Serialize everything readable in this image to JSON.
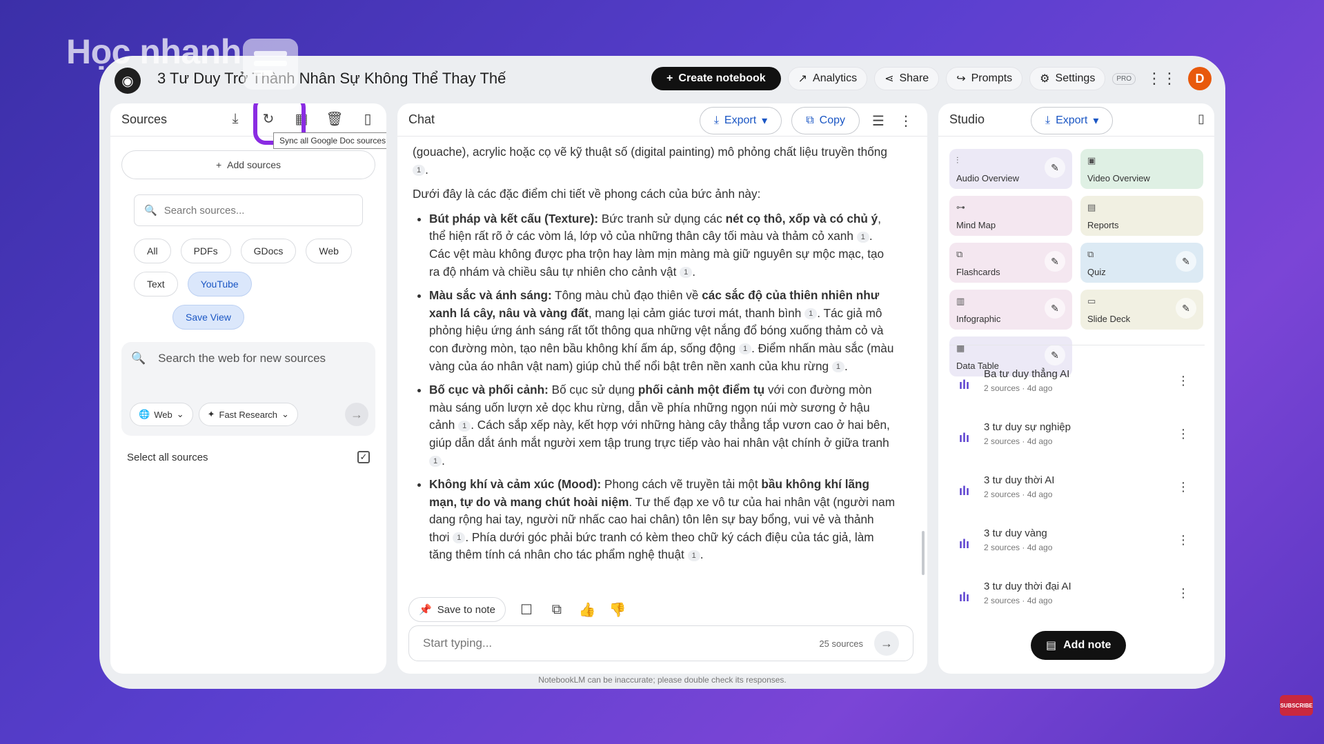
{
  "watermark": {
    "brand": "Học nhanh"
  },
  "topbar": {
    "notebook_title": "3 Tư Duy Trở Thành Nhân Sự Không Thể Thay Thế",
    "create_notebook": "Create notebook",
    "analytics": "Analytics",
    "share": "Share",
    "prompts": "Prompts",
    "settings": "Settings",
    "pro_badge": "PRO",
    "avatar_letter": "D"
  },
  "sources": {
    "title": "Sources",
    "tooltip": "Sync all Google Doc sources",
    "add_sources": "Add sources",
    "search_placeholder": "Search sources...",
    "filters": [
      "All",
      "PDFs",
      "GDocs",
      "Web",
      "Text",
      "YouTube"
    ],
    "active_filter": "YouTube",
    "save_view": "Save View",
    "web_search_placeholder": "Search the web for new sources",
    "web_option": "Web",
    "research_option": "Fast Research",
    "select_all": "Select all sources"
  },
  "chat": {
    "title": "Chat",
    "export": "Export",
    "copy": "Copy",
    "intro_continuation": "(gouache), acrylic hoặc cọ vẽ kỹ thuật số (digital painting) mô phỏng chất liệu truyền thống",
    "lead": "Dưới đây là các đặc điểm chi tiết về phong cách của bức ảnh này:",
    "bullets": [
      {
        "head": "Bút pháp và kết cấu (Texture):",
        "text_a": " Bức tranh sử dụng các ",
        "bold_a": "nét cọ thô, xốp và có chủ ý",
        "text_b": ", thể hiện rất rõ ở các vòm lá, lớp vỏ của những thân cây tối màu và thảm cỏ xanh",
        "text_c": ". Các vệt màu không được pha trộn hay làm mịn màng mà giữ nguyên sự mộc mạc, tạo ra độ nhám và chiều sâu tự nhiên cho cảnh vật"
      },
      {
        "head": "Màu sắc và ánh sáng:",
        "text_a": " Tông màu chủ đạo thiên về ",
        "bold_a": "các sắc độ của thiên nhiên như xanh lá cây, nâu và vàng đất",
        "text_b": ", mang lại cảm giác tươi mát, thanh bình",
        "text_c": ". Tác giả mô phỏng hiệu ứng ánh sáng rất tốt thông qua những vệt nắng đổ bóng xuống thảm cỏ và con đường mòn, tạo nên bầu không khí ấm áp, sống động",
        "text_d": ". Điểm nhấn màu sắc (màu vàng của áo nhân vật nam) giúp chủ thể nổi bật trên nền xanh của khu rừng"
      },
      {
        "head": "Bố cục và phối cảnh:",
        "text_a": " Bố cục sử dụng ",
        "bold_a": "phối cảnh một điểm tụ",
        "text_b": " với con đường mòn màu sáng uốn lượn xẻ dọc khu rừng, dẫn về phía những ngọn núi mờ sương ở hậu cảnh",
        "text_c": ". Cách sắp xếp này, kết hợp với những hàng cây thẳng tắp vươn cao ở hai bên, giúp dẫn dắt ánh mắt người xem tập trung trực tiếp vào hai nhân vật chính ở giữa tranh"
      },
      {
        "head": "Không khí và cảm xúc (Mood):",
        "text_a": " Phong cách vẽ truyền tải một ",
        "bold_a": "bầu không khí lãng mạn, tự do và mang chút hoài niệm",
        "text_b": ". Tư thế đạp xe vô tư của hai nhân vật (người nam dang rộng hai tay, người nữ nhấc cao hai chân) tôn lên sự bay bổng, vui vẻ và thảnh thơi",
        "text_c": ". Phía dưới góc phải bức tranh có kèm theo chữ ký cách điệu của tác giả, làm tăng thêm tính cá nhân cho tác phẩm nghệ thuật"
      }
    ],
    "cite": "1",
    "save_to_note": "Save to note",
    "input_placeholder": "Start typing...",
    "source_count": "25 sources",
    "disclaimer": "NotebookLM can be inaccurate; please double check its responses."
  },
  "studio": {
    "title": "Studio",
    "export": "Export",
    "tiles": [
      {
        "label": "Audio Overview",
        "icon": "audio-icon"
      },
      {
        "label": "Video Overview",
        "icon": "video-icon"
      },
      {
        "label": "Mind Map",
        "icon": "mindmap-icon"
      },
      {
        "label": "Reports",
        "icon": "reports-icon"
      },
      {
        "label": "Flashcards",
        "icon": "flashcards-icon"
      },
      {
        "label": "Quiz",
        "icon": "quiz-icon"
      },
      {
        "label": "Infographic",
        "icon": "infographic-icon"
      },
      {
        "label": "Slide Deck",
        "icon": "slides-icon"
      },
      {
        "label": "Data Table",
        "icon": "table-icon"
      }
    ],
    "notes": [
      {
        "title": "Ba tư duy thẳng AI",
        "meta": "2 sources · 4d ago"
      },
      {
        "title": "3 tư duy sự nghiệp",
        "meta": "2 sources · 4d ago"
      },
      {
        "title": "3 tư duy thời AI",
        "meta": "2 sources · 4d ago"
      },
      {
        "title": "3 tư duy vàng",
        "meta": "2 sources · 4d ago"
      },
      {
        "title": "3 tư duy thời đại AI",
        "meta": "2 sources · 4d ago"
      }
    ],
    "add_note": "Add note"
  },
  "subscribe_badge": "SUBSCRIBE"
}
